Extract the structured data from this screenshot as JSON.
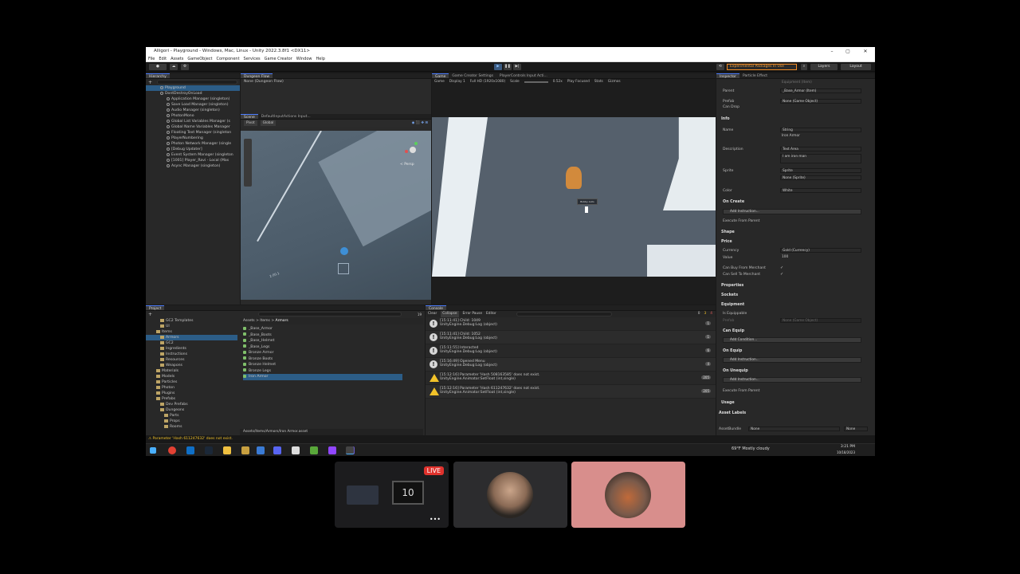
{
  "window": {
    "title": "Alligori - Playground - Windows, Mac, Linux - Unity 2022.3.8f1 <DX11>",
    "controls": [
      "–",
      "▢",
      "✕"
    ]
  },
  "menu": [
    "File",
    "Edit",
    "Assets",
    "GameObject",
    "Component",
    "Services",
    "Game Creator",
    "Window",
    "Help"
  ],
  "toolbar": {
    "experimental": "Experimental Packages In Use",
    "layers": "Layers",
    "layout": "Layout"
  },
  "hierarchy": {
    "tab": "Hierarchy",
    "items": [
      {
        "label": "Playground",
        "indent": 0
      },
      {
        "label": "DontDestroyOnLoad",
        "indent": 0
      },
      {
        "label": "Application Manager (singleton)",
        "indent": 1
      },
      {
        "label": "Save Load Manager (singleton)",
        "indent": 1
      },
      {
        "label": "Audio Manager (singleton)",
        "indent": 1
      },
      {
        "label": "PhotonMono",
        "indent": 1
      },
      {
        "label": "Global List Variables Manager (s",
        "indent": 1
      },
      {
        "label": "Global Name Variables Manager",
        "indent": 1
      },
      {
        "label": "Floating Text Manager (singleton",
        "indent": 1
      },
      {
        "label": "PlayerNumbering",
        "indent": 1
      },
      {
        "label": "Photon Network Manager (single",
        "indent": 1
      },
      {
        "label": "[Debug Updater]",
        "indent": 1
      },
      {
        "label": "Event System Manager (singleton",
        "indent": 1
      },
      {
        "label": "[1001] Player_Ravi - Local (Mas",
        "indent": 1
      },
      {
        "label": "Async Manager (singleton)",
        "indent": 1
      }
    ]
  },
  "dungeon_flow": {
    "tab": "Dungeon Flow",
    "field": "None (Dungeon Flow)"
  },
  "scene": {
    "tabs": [
      "Scene",
      "DefaultInputActions Input..."
    ],
    "pivot": "Pivot",
    "global": "Global",
    "persp": "< Persp",
    "grid_label": "2.00.1"
  },
  "game": {
    "tabs": [
      "Game",
      "Game Creator Settings",
      "PlayerControls Input Acti..."
    ],
    "display": "Game",
    "display_num": "Display 1",
    "resolution": "Full HD (1920x1080)",
    "scale_label": "Scale",
    "scale_value": "0.52x",
    "play_focused": "Play Focused",
    "stats": "Stats",
    "gizmos": "Gizmos",
    "name_tag": "Bobby Auto"
  },
  "project": {
    "tab": "Project",
    "breadcrumb": [
      "Assets",
      "Items",
      "Armors"
    ],
    "tree": [
      {
        "label": "GC2 Templates",
        "indent": 2
      },
      {
        "label": "UI",
        "indent": 2
      },
      {
        "label": "Items",
        "indent": 1
      },
      {
        "label": "Armors",
        "indent": 2
      },
      {
        "label": "GC2",
        "indent": 2
      },
      {
        "label": "Ingredients",
        "indent": 2
      },
      {
        "label": "Instructions",
        "indent": 2
      },
      {
        "label": "Resources",
        "indent": 2
      },
      {
        "label": "Weapons",
        "indent": 2
      },
      {
        "label": "Materials",
        "indent": 1
      },
      {
        "label": "Models",
        "indent": 1
      },
      {
        "label": "Particles",
        "indent": 1
      },
      {
        "label": "Photon",
        "indent": 1
      },
      {
        "label": "Plugins",
        "indent": 1
      },
      {
        "label": "Prefabs",
        "indent": 1
      },
      {
        "label": "Dev Prefabs",
        "indent": 2
      },
      {
        "label": "Dungeons",
        "indent": 2
      },
      {
        "label": "Parts",
        "indent": 3
      },
      {
        "label": "Props",
        "indent": 3
      },
      {
        "label": "Rooms",
        "indent": 3
      }
    ],
    "files": [
      "_Base_Armor",
      "_Base_Boots",
      "_Base_Helmet",
      "_Base_Legs",
      "Bronze Armor",
      "Bronze Boots",
      "Bronze Helmet",
      "Bronze Legs",
      "Iron Armor"
    ],
    "path": "Assets/Items/Armors/Iron Armor.asset",
    "badge": "19"
  },
  "console": {
    "tab": "Console",
    "buttons": [
      "Clear",
      "Collapse",
      "Error Pause",
      "Editor"
    ],
    "counts": [
      "0",
      "3",
      "4"
    ],
    "rows": [
      {
        "type": "info",
        "line1": "[15:11:41] Child: 1049",
        "line2": "UnityEngine.Debug:Log (object)",
        "count": "1"
      },
      {
        "type": "info",
        "line1": "[15:11:41] Child: 1052",
        "line2": "UnityEngine.Debug:Log (object)",
        "count": "1"
      },
      {
        "type": "info",
        "line1": "[15:11:55] Interacted",
        "line2": "UnityEngine.Debug:Log (object)",
        "count": "6"
      },
      {
        "type": "info",
        "line1": "[15:16:49] Opened Menu",
        "line2": "UnityEngine.Debug:Log (object)",
        "count": "4"
      },
      {
        "type": "warn",
        "line1": "[15:12:16] Parameter 'Hash 508163585' does not exist.",
        "line2": "UnityEngine.Animator:SetFloat (int,single)",
        "count": "205"
      },
      {
        "type": "warn",
        "line1": "[15:12:16] Parameter 'Hash 611247632' does not exist.",
        "line2": "UnityEngine.Animator:SetFloat (int,single)",
        "count": "205"
      }
    ]
  },
  "inspector": {
    "tabs": [
      "Inspector",
      "Particle Effect"
    ],
    "top_faded": "Equipment (Item)",
    "parent_label": "Parent",
    "parent_value": "_Base_Armor (Item)",
    "prefab_label": "Prefab",
    "prefab_value": "None (Game Object)",
    "can_drop": "Can Drop",
    "info": "Info",
    "name_label": "Name",
    "name_type": "String",
    "name_value": "Iron Armor",
    "desc_label": "Description",
    "desc_type": "Text Area",
    "desc_value": "I am iron man",
    "sprite_label": "Sprite",
    "sprite_type": "Sprite",
    "sprite_value": "None (Sprite)",
    "color_label": "Color",
    "color_value": "White",
    "on_create": "On Create",
    "add_instruction": "Add Instruction...",
    "exec_parent": "Execute From Parent",
    "shape": "Shape",
    "price": "Price",
    "currency_label": "Currency",
    "currency_value": "Gold (Currency)",
    "value_label": "Value",
    "value_value": "100",
    "buy_label": "Can Buy From Merchant",
    "sell_label": "Can Sell To Merchant",
    "properties": "Properties",
    "sockets": "Sockets",
    "equipment": "Equipment",
    "is_equippable": "Is Equippable",
    "prefab2_label": "Prefab",
    "prefab2_value": "None (Game Object)",
    "can_equip": "Can Equip",
    "add_condition": "Add Condition...",
    "on_equip": "On Equip",
    "on_unequip": "On Unequip",
    "usage": "Usage",
    "asset_labels": "Asset Labels",
    "asset_bundle": "AssetBundle",
    "bundle_none": "None",
    "bundle_none2": "None"
  },
  "status_bar": {
    "error": "Parameter 'Hash 611247632' does not exist."
  },
  "taskbar": {
    "weather": "69°F  Mostly cloudy",
    "time": "3:21 PM",
    "date": "10/18/2023"
  },
  "stream": {
    "live": "LIVE",
    "cam_number": "10",
    "more": "•••"
  }
}
